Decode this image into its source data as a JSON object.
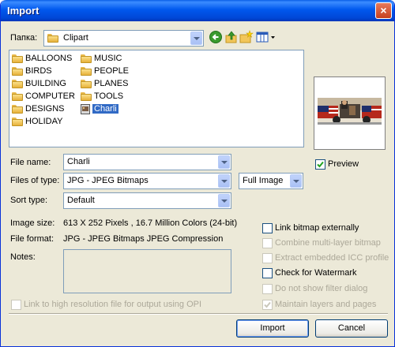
{
  "window": {
    "title": "Import",
    "close_glyph": "×"
  },
  "lookin": {
    "label": "Папка:",
    "value": "Clipart"
  },
  "toolbar": {
    "icons": [
      "back-icon",
      "up-folder-icon",
      "new-folder-icon",
      "view-menu-icon"
    ]
  },
  "folders": [
    {
      "name": "BALLOONS",
      "selected": false
    },
    {
      "name": "BIRDS",
      "selected": false
    },
    {
      "name": "BUILDING",
      "selected": false
    },
    {
      "name": "COMPUTER",
      "selected": false
    },
    {
      "name": "DESIGNS",
      "selected": false
    },
    {
      "name": "HOLIDAY",
      "selected": false
    },
    {
      "name": "MUSIC",
      "selected": false
    },
    {
      "name": "PEOPLE",
      "selected": false
    },
    {
      "name": "PLANES",
      "selected": false
    },
    {
      "name": "TOOLS",
      "selected": false
    },
    {
      "name": "Charli",
      "selected": true,
      "is_file": true
    }
  ],
  "preview": {
    "label": "Preview",
    "checked": true
  },
  "filename": {
    "label": "File name:",
    "value": "Charli"
  },
  "filetype": {
    "label": "Files of type:",
    "value": "JPG - JPEG Bitmaps",
    "mode": "Full Image"
  },
  "sorttype": {
    "label": "Sort type:",
    "value": "Default"
  },
  "info": {
    "size_label": "Image size:",
    "size_value": "613 X 252 Pixels , 16.7 Million Colors (24-bit)",
    "format_label": "File format:",
    "format_value": "JPG - JPEG Bitmaps JPEG Compression",
    "notes_label": "Notes:"
  },
  "options": {
    "link_bitmap": {
      "label": "Link bitmap externally",
      "checked": false,
      "enabled": true
    },
    "combine": {
      "label": "Combine multi-layer bitmap",
      "checked": false,
      "enabled": false
    },
    "extract_icc": {
      "label": "Extract embedded ICC profile",
      "checked": false,
      "enabled": false
    },
    "watermark": {
      "label": "Check for Watermark",
      "checked": false,
      "enabled": true
    },
    "no_filter": {
      "label": "Do not show filter dialog",
      "checked": false,
      "enabled": false
    },
    "maintain": {
      "label": "Maintain layers and pages",
      "checked": true,
      "enabled": false
    },
    "opi": {
      "label": "Link to high resolution file for output using OPI",
      "checked": false,
      "enabled": false
    }
  },
  "buttons": {
    "import": "Import",
    "cancel": "Cancel"
  }
}
